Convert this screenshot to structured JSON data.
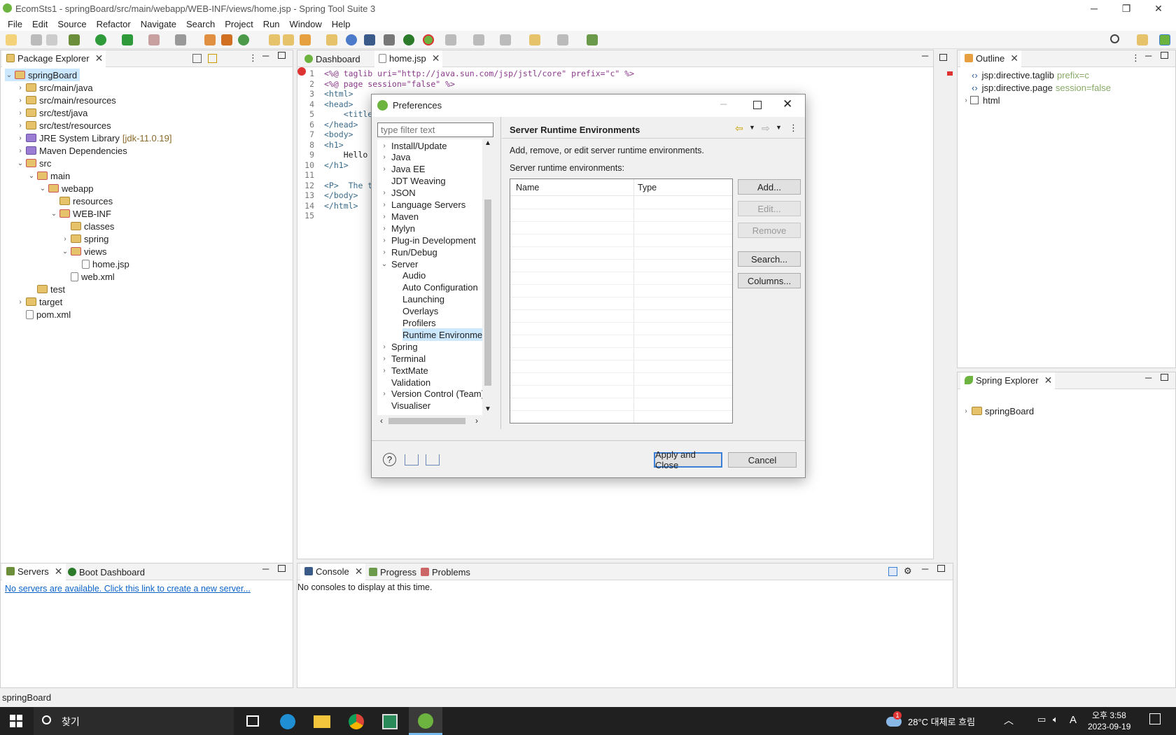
{
  "window": {
    "title": "EcomSts1 - springBoard/src/main/webapp/WEB-INF/views/home.jsp - Spring Tool Suite 3",
    "min_label": "─",
    "restore_label": "❐",
    "close_label": "✕"
  },
  "menu": [
    "File",
    "Edit",
    "Source",
    "Refactor",
    "Navigate",
    "Search",
    "Project",
    "Run",
    "Window",
    "Help"
  ],
  "package_explorer": {
    "tab_label": "Package Explorer",
    "rows": [
      {
        "label": "springBoard",
        "extra": ""
      },
      {
        "label": "src/main/java",
        "extra": ""
      },
      {
        "label": "src/main/resources",
        "extra": ""
      },
      {
        "label": "src/test/java",
        "extra": ""
      },
      {
        "label": "src/test/resources",
        "extra": ""
      },
      {
        "label": "JRE System Library",
        "extra": "[jdk-11.0.19]"
      },
      {
        "label": "Maven Dependencies",
        "extra": ""
      },
      {
        "label": "src",
        "extra": ""
      },
      {
        "label": "main",
        "extra": ""
      },
      {
        "label": "webapp",
        "extra": ""
      },
      {
        "label": "resources",
        "extra": ""
      },
      {
        "label": "WEB-INF",
        "extra": ""
      },
      {
        "label": "classes",
        "extra": ""
      },
      {
        "label": "spring",
        "extra": ""
      },
      {
        "label": "views",
        "extra": ""
      },
      {
        "label": "home.jsp",
        "extra": ""
      },
      {
        "label": "web.xml",
        "extra": ""
      },
      {
        "label": "test",
        "extra": ""
      },
      {
        "label": "target",
        "extra": ""
      },
      {
        "label": "pom.xml",
        "extra": ""
      }
    ]
  },
  "editor": {
    "tabs": [
      "Dashboard",
      "home.jsp"
    ],
    "line_numbers": [
      "1",
      "2",
      "3",
      "4",
      "5",
      "6",
      "7",
      "8",
      "9",
      "10",
      "11",
      "12",
      "13",
      "14",
      "15"
    ],
    "lines": [
      "<%@ taglib uri=\"http://java.sun.com/jsp/jstl/core\" prefix=\"c\" %>",
      "<%@ page session=\"false\" %>",
      "<html>",
      "<head>",
      "    <title",
      "</head>",
      "<body>",
      "<h1>",
      "    Hello",
      "</h1>",
      "",
      "<P>  The t",
      "</body>",
      "</html>",
      ""
    ]
  },
  "outline": {
    "tab_label": "Outline",
    "items": [
      {
        "label": "jsp:directive.taglib",
        "extra": "prefix=c"
      },
      {
        "label": "jsp:directive.page",
        "extra": "session=false"
      },
      {
        "label": "html",
        "extra": ""
      }
    ]
  },
  "spring_explorer": {
    "tab_label": "Spring Explorer",
    "items": [
      "springBoard"
    ]
  },
  "servers": {
    "tab_label": "Servers",
    "boot_tab_label": "Boot Dashboard",
    "link_text": "No servers are available. Click this link to create a new server..."
  },
  "console": {
    "tabs": [
      "Console",
      "Progress",
      "Problems"
    ],
    "message": "No consoles to display at this time."
  },
  "status_bar": {
    "text": "springBoard"
  },
  "preferences": {
    "title": "Preferences",
    "filter_placeholder": "type filter text",
    "tree": [
      {
        "label": "Install/Update",
        "level": 0,
        "chev": "›"
      },
      {
        "label": "Java",
        "level": 0,
        "chev": "›"
      },
      {
        "label": "Java EE",
        "level": 0,
        "chev": "›"
      },
      {
        "label": "JDT Weaving",
        "level": 0,
        "chev": ""
      },
      {
        "label": "JSON",
        "level": 0,
        "chev": "›"
      },
      {
        "label": "Language Servers",
        "level": 0,
        "chev": "›"
      },
      {
        "label": "Maven",
        "level": 0,
        "chev": "›"
      },
      {
        "label": "Mylyn",
        "level": 0,
        "chev": "›"
      },
      {
        "label": "Plug-in Development",
        "level": 0,
        "chev": "›"
      },
      {
        "label": "Run/Debug",
        "level": 0,
        "chev": "›"
      },
      {
        "label": "Server",
        "level": 0,
        "chev": "⌄"
      },
      {
        "label": "Audio",
        "level": 1,
        "chev": ""
      },
      {
        "label": "Auto Configuration",
        "level": 1,
        "chev": ""
      },
      {
        "label": "Launching",
        "level": 1,
        "chev": ""
      },
      {
        "label": "Overlays",
        "level": 1,
        "chev": ""
      },
      {
        "label": "Profilers",
        "level": 1,
        "chev": ""
      },
      {
        "label": "Runtime Environmen",
        "level": 1,
        "chev": ""
      },
      {
        "label": "Spring",
        "level": 0,
        "chev": "›"
      },
      {
        "label": "Terminal",
        "level": 0,
        "chev": "›"
      },
      {
        "label": "TextMate",
        "level": 0,
        "chev": "›"
      },
      {
        "label": "Validation",
        "level": 0,
        "chev": ""
      },
      {
        "label": "Version Control (Team)",
        "level": 0,
        "chev": "›"
      },
      {
        "label": "Visualiser",
        "level": 0,
        "chev": ""
      }
    ],
    "selected_index": 16,
    "page_title": "Server Runtime Environments",
    "description": "Add, remove, or edit server runtime environments.",
    "list_label": "Server runtime environments:",
    "columns": [
      "Name",
      "Type"
    ],
    "buttons": {
      "add": "Add...",
      "edit": "Edit...",
      "remove": "Remove",
      "search": "Search...",
      "columns": "Columns..."
    },
    "apply_close": "Apply and Close",
    "cancel": "Cancel"
  },
  "taskbar": {
    "search_text": "찾기",
    "weather": "28°C  대체로 흐림",
    "time": "오후 3:58",
    "date": "2023-09-19",
    "notif_count": "1",
    "ime": "A"
  },
  "colors": {
    "accent": "#3c7fd6",
    "link": "#0b63c9",
    "selection": "#cce8ff",
    "taskbar": "#202020"
  }
}
